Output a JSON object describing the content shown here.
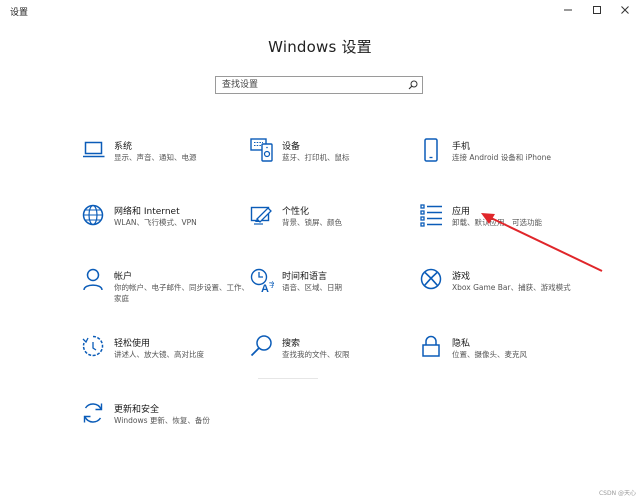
{
  "window": {
    "title": "设置",
    "controls": {
      "minimize_icon": "minimize-icon",
      "maximize_icon": "maximize-icon",
      "close_icon": "close-icon"
    }
  },
  "heading": "Windows 设置",
  "search": {
    "placeholder": "查找设置",
    "value": "",
    "icon": "search-icon"
  },
  "categories": [
    {
      "name": "系统",
      "desc": "显示、声音、通知、电源",
      "icon": "laptop-icon"
    },
    {
      "name": "设备",
      "desc": "蓝牙、打印机、鼠标",
      "icon": "keyboard-icon"
    },
    {
      "name": "手机",
      "desc": "连接 Android 设备和 iPhone",
      "icon": "phone-icon"
    },
    {
      "name": "网络和 Internet",
      "desc": "WLAN、飞行模式、VPN",
      "icon": "globe-icon"
    },
    {
      "name": "个性化",
      "desc": "背景、锁屏、颜色",
      "icon": "paint-icon"
    },
    {
      "name": "应用",
      "desc": "卸载、默认应用、可选功能",
      "icon": "apps-list-icon"
    },
    {
      "name": "帐户",
      "desc": "你的帐户、电子邮件、同步设置、工作、家庭",
      "icon": "person-icon"
    },
    {
      "name": "时间和语言",
      "desc": "语音、区域、日期",
      "icon": "time-language-icon"
    },
    {
      "name": "游戏",
      "desc": "Xbox Game Bar、捕获、游戏模式",
      "icon": "xbox-icon"
    },
    {
      "name": "轻松使用",
      "desc": "讲述人、放大镜、高对比度",
      "icon": "ease-of-access-icon"
    },
    {
      "name": "搜索",
      "desc": "查找我的文件、权限",
      "icon": "magnifier-icon"
    },
    {
      "name": "隐私",
      "desc": "位置、摄像头、麦克风",
      "icon": "lock-icon"
    },
    {
      "name": "更新和安全",
      "desc": "Windows 更新、恢复、备份",
      "icon": "update-icon"
    }
  ],
  "colors": {
    "accent": "#0b5cb8",
    "annotation": "#e0262a",
    "text": "#1a1a1a",
    "subtext": "#555555"
  },
  "watermark": "CSDN @天心"
}
